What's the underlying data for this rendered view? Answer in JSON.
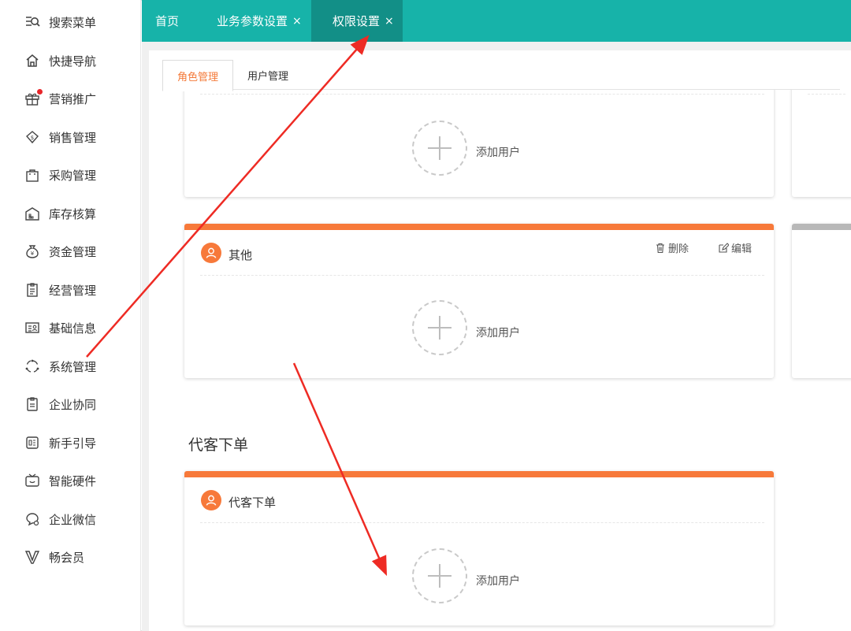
{
  "sidebar": {
    "items": [
      {
        "label": "搜索菜单",
        "icon": "search-menu-icon"
      },
      {
        "label": "快捷导航",
        "icon": "home-icon"
      },
      {
        "label": "营销推广",
        "icon": "gift-icon",
        "badge_dot": true
      },
      {
        "label": "销售管理",
        "icon": "sales-icon"
      },
      {
        "label": "采购管理",
        "icon": "bag-icon"
      },
      {
        "label": "库存核算",
        "icon": "warehouse-icon"
      },
      {
        "label": "资金管理",
        "icon": "money-bag-icon"
      },
      {
        "label": "经营管理",
        "icon": "clipboard-icon"
      },
      {
        "label": "基础信息",
        "icon": "id-card-icon"
      },
      {
        "label": "系统管理",
        "icon": "system-icon"
      },
      {
        "label": "企业协同",
        "icon": "collaboration-icon"
      },
      {
        "label": "新手引导",
        "icon": "guide-icon"
      },
      {
        "label": "智能硬件",
        "icon": "tv-icon"
      },
      {
        "label": "企业微信",
        "icon": "chat-icon"
      },
      {
        "label": "畅会员",
        "icon": "vip-v-icon"
      }
    ]
  },
  "tabs": [
    {
      "label": "首页",
      "closable": false,
      "active": false
    },
    {
      "label": "业务参数设置",
      "closable": true,
      "active": false
    },
    {
      "label": "权限设置",
      "closable": true,
      "active": true
    }
  ],
  "tab_close_glyph": "×",
  "subtabs": [
    {
      "label": "角色管理",
      "active": true
    },
    {
      "label": "用户管理",
      "active": false
    }
  ],
  "cards": {
    "top": {
      "add_label": "添加用户"
    },
    "other": {
      "role_name": "其他",
      "delete_label": "删除",
      "edit_label": "编辑",
      "add_label": "添加用户"
    },
    "proxy": {
      "role_name": "代客下单",
      "add_label": "添加用户"
    }
  },
  "section_title": "代客下单",
  "colors": {
    "topbar": "#17b3a9",
    "active_tab": "#128f87",
    "accent": "#f7793a",
    "arrow": "#ee2b24"
  }
}
